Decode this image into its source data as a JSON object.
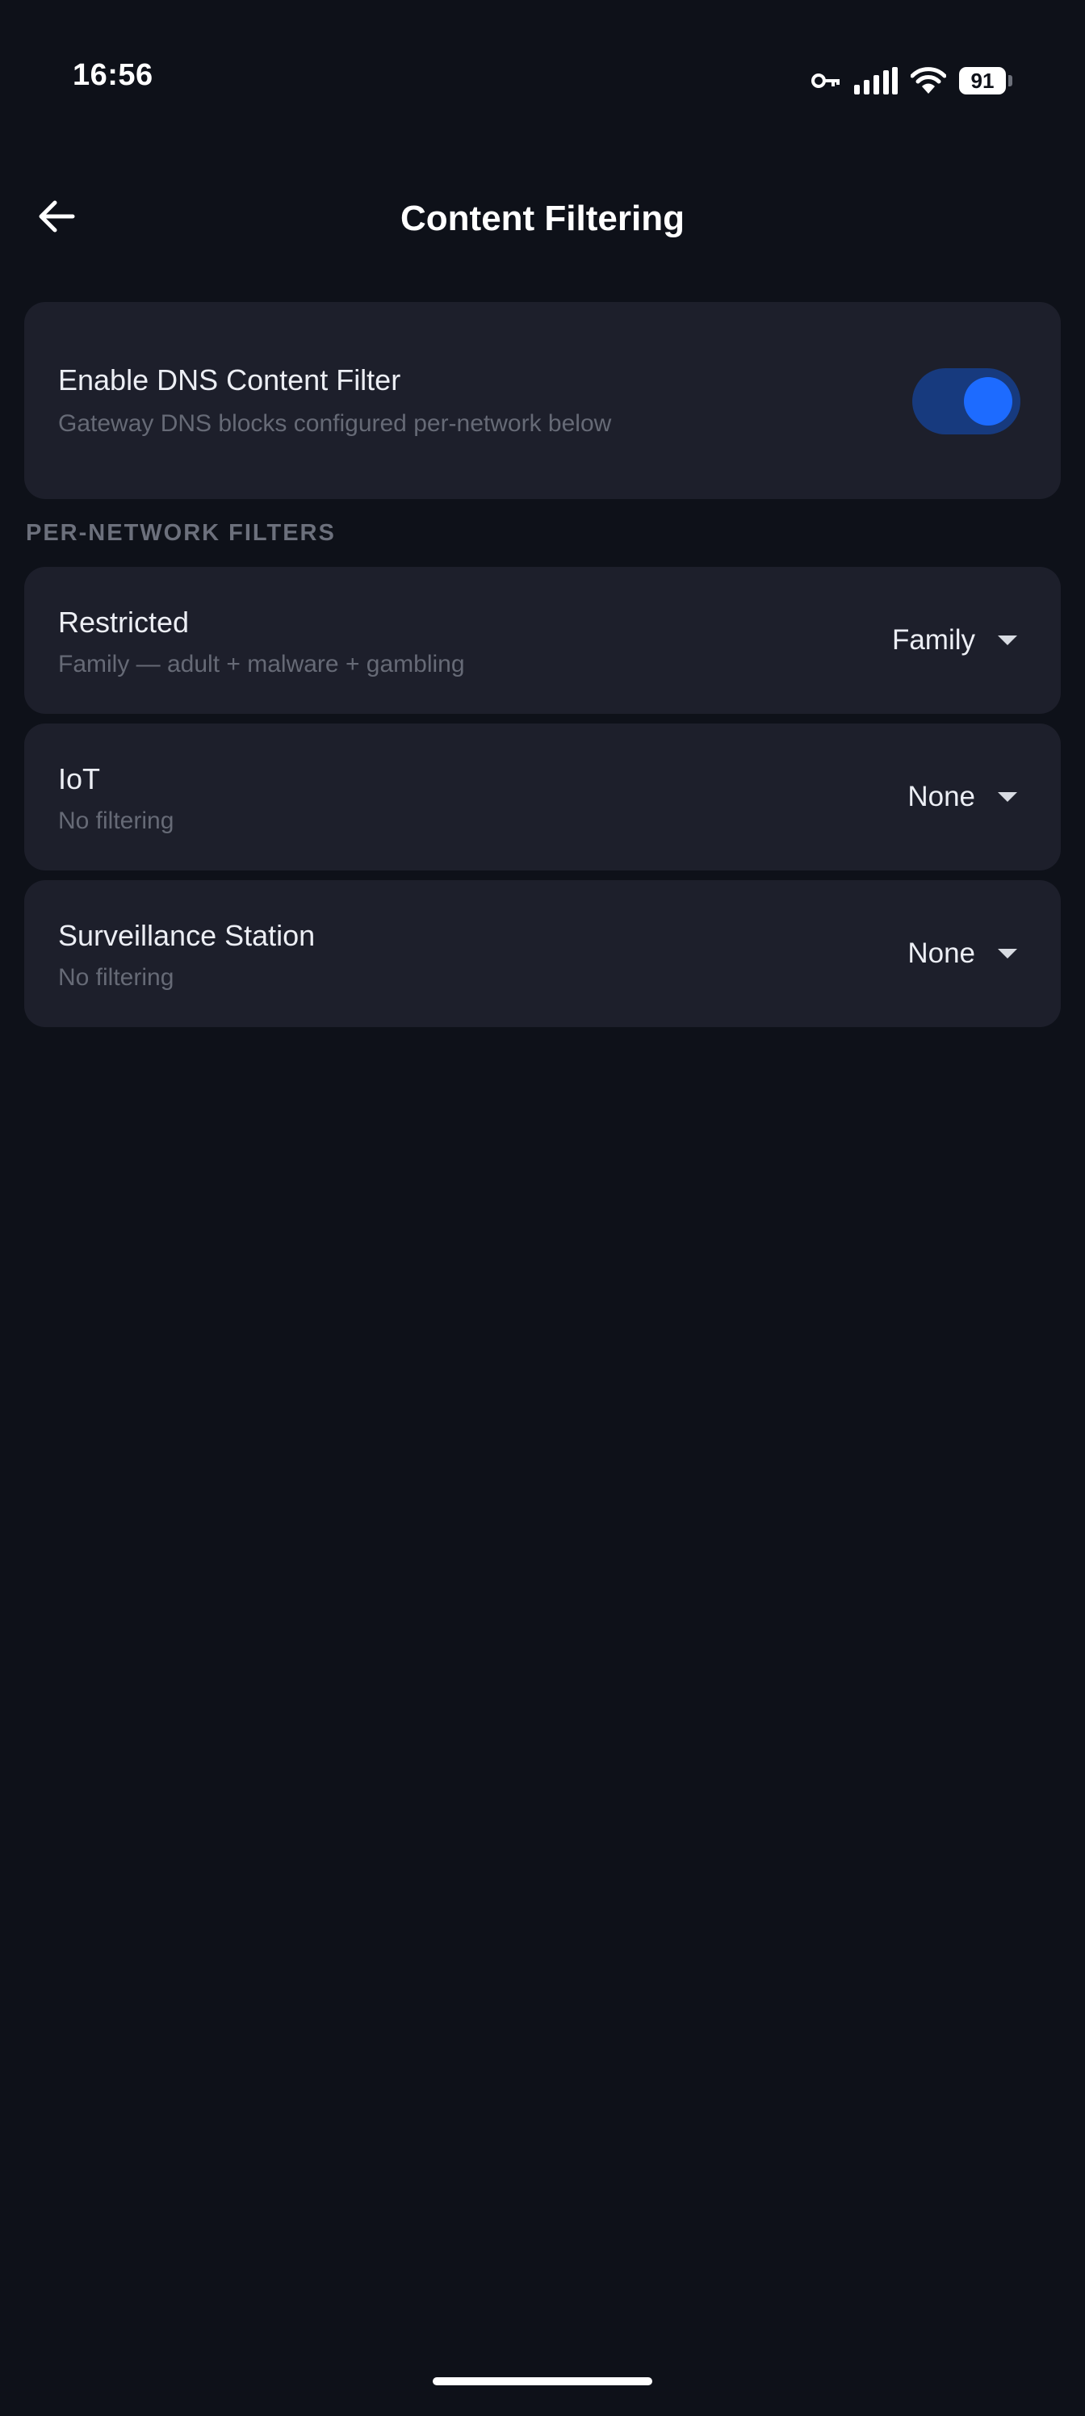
{
  "status_bar": {
    "time": "16:56",
    "battery_level": "91",
    "icons": [
      "vpn-key-icon",
      "signal-icon",
      "wifi-icon",
      "battery-icon"
    ]
  },
  "header": {
    "title": "Content Filtering",
    "back_icon": "arrow-left-icon"
  },
  "dns_filter": {
    "title": "Enable DNS Content Filter",
    "subtitle": "Gateway DNS blocks configured per-network below",
    "enabled": true
  },
  "section_title": "PER-NETWORK FILTERS",
  "networks": [
    {
      "name": "Restricted",
      "description": "Family — adult + malware + gambling",
      "selected": "Family"
    },
    {
      "name": "IoT",
      "description": "No filtering",
      "selected": "None"
    },
    {
      "name": "Surveillance Station",
      "description": "No filtering",
      "selected": "None"
    }
  ],
  "colors": {
    "background": "#0e1119",
    "card": "#1d1f2b",
    "accent": "#1d6bff",
    "toggle_track": "#173a7e",
    "muted_text": "#666a76"
  }
}
